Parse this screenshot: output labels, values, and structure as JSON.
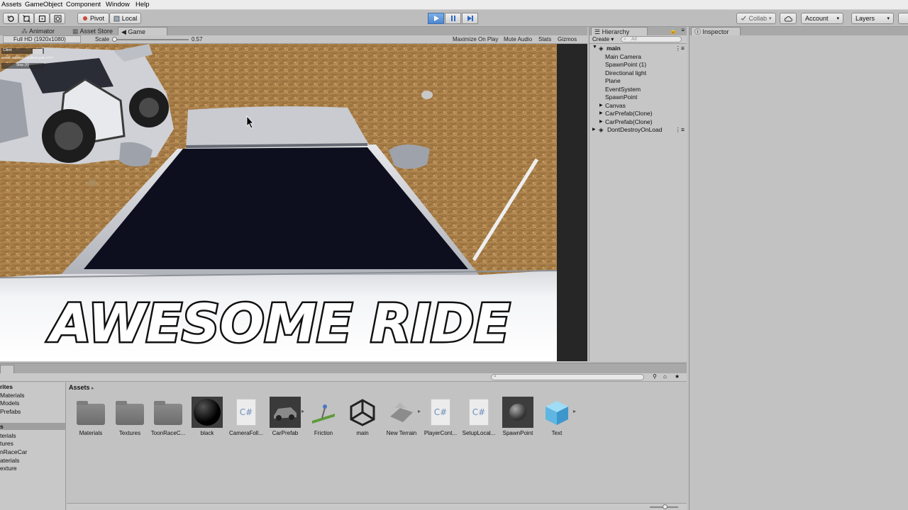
{
  "menu": [
    "Assets",
    "GameObject",
    "Component",
    "Window",
    "Help"
  ],
  "toolbar": {
    "pivot": "Pivot",
    "local": "Local",
    "collab": "Collab",
    "account": "Account",
    "layers": "Layers"
  },
  "game_tabs": [
    "Animator",
    "Asset Store",
    "Game"
  ],
  "gamebar": {
    "resolution": "Full HD (1920x1080)",
    "scale_label": "Scale",
    "scale_value": "0.57",
    "maximize": "Maximize On Play",
    "mute": "Mute Audio",
    "stats": "Stats",
    "gizmos": "Gizmos"
  },
  "overlay": {
    "line1": "Client",
    "line2": "server: address=localhost port=7777",
    "stop": "Stop (X)"
  },
  "viewport_text": "AWESOME RIDE",
  "hierarchy": {
    "tab": "Hierarchy",
    "create": "Create",
    "search_placeholder": "All",
    "scene": "main",
    "items": [
      "Main Camera",
      "SpawnPoint (1)",
      "Directional light",
      "Plane",
      "EventSystem",
      "SpawnPoint",
      "Canvas",
      "CarPrefab(Clone)",
      "CarPrefab(Clone)"
    ],
    "dont_destroy": "DontDestroyOnLoad"
  },
  "inspector": {
    "tab": "Inspector"
  },
  "project": {
    "breadcrumb": "Assets",
    "favorites": [
      "rites",
      "Materials",
      "Models",
      "Prefabs",
      "s",
      "terials",
      "tures",
      "nRaceCar",
      "aterials",
      "exture"
    ],
    "assets": [
      "Materials",
      "Textures",
      "ToonRaceC...",
      "black",
      "CameraFoll...",
      "CarPrefab",
      "Friction",
      "main",
      "New Terrain",
      "PlayerCont...",
      "SetupLocal...",
      "SpawnPoint",
      "Text"
    ]
  },
  "colors": {
    "play_active": "#4d86cf",
    "selection": "#3d6fd1"
  }
}
